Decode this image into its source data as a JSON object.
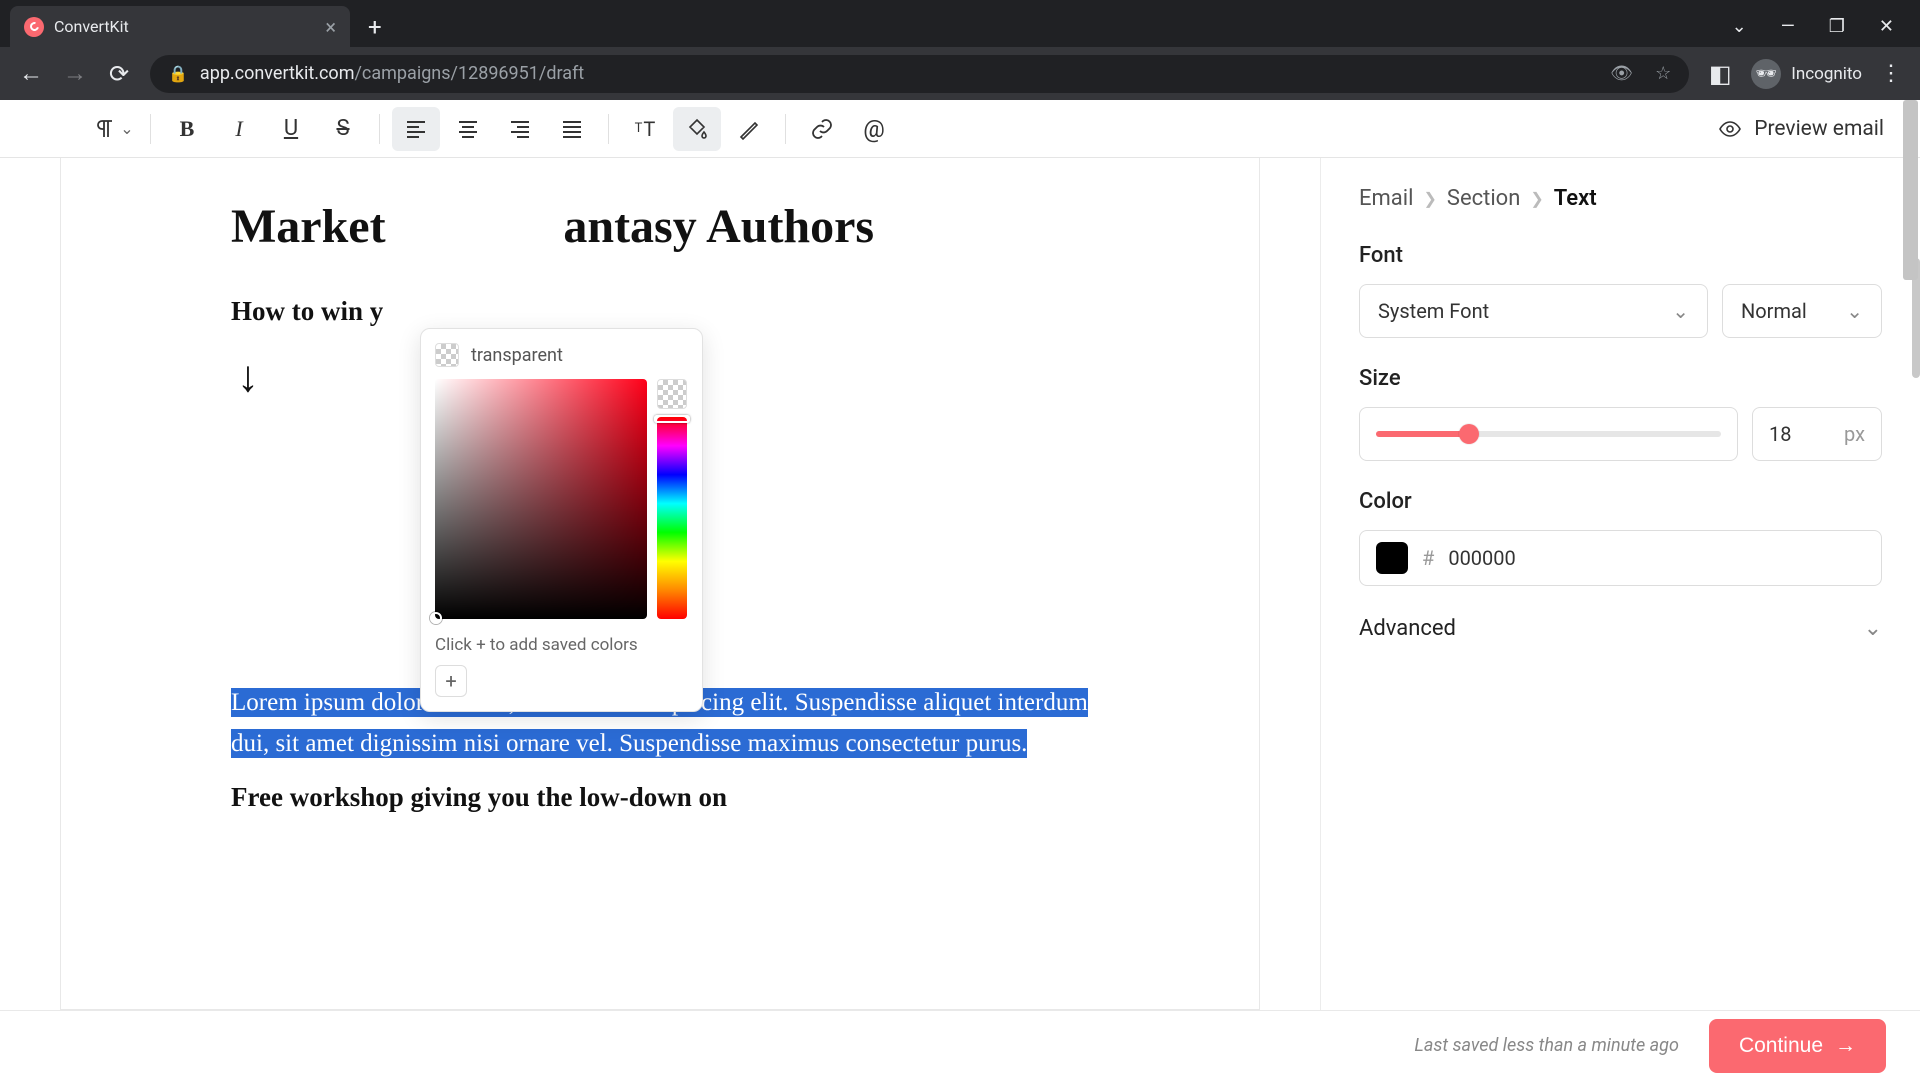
{
  "browser": {
    "tab_title": "ConvertKit",
    "url_domain": "app.convertkit.com",
    "url_path": "/campaigns/12896951/draft",
    "incognito_label": "Incognito"
  },
  "toolbar": {
    "preview_label": "Preview email"
  },
  "content": {
    "heading_visible_left": "Market",
    "heading_visible_right": "antasy Authors",
    "subheading_visible": "How to win y",
    "arrow": "↓",
    "selected_paragraph": "Lorem ipsum dolor sit amet, consectetur adipiscing elit. Suspendisse aliquet interdum dui, sit amet dignissim nisi ornare vel. Suspendisse maximus consectetur purus.",
    "workshop_heading": "Free workshop giving you the low-down on"
  },
  "color_picker": {
    "current_label": "transparent",
    "saved_hint": "Click + to add saved colors",
    "add_symbol": "+"
  },
  "panel": {
    "breadcrumb": [
      "Email",
      "Section",
      "Text"
    ],
    "font_label": "Font",
    "font_family": "System Font",
    "font_weight": "Normal",
    "size_label": "Size",
    "size_value": "18",
    "size_unit": "px",
    "color_label": "Color",
    "color_hex": "000000",
    "advanced_label": "Advanced"
  },
  "footer": {
    "saved_text": "Last saved less than a minute ago",
    "continue_label": "Continue"
  }
}
